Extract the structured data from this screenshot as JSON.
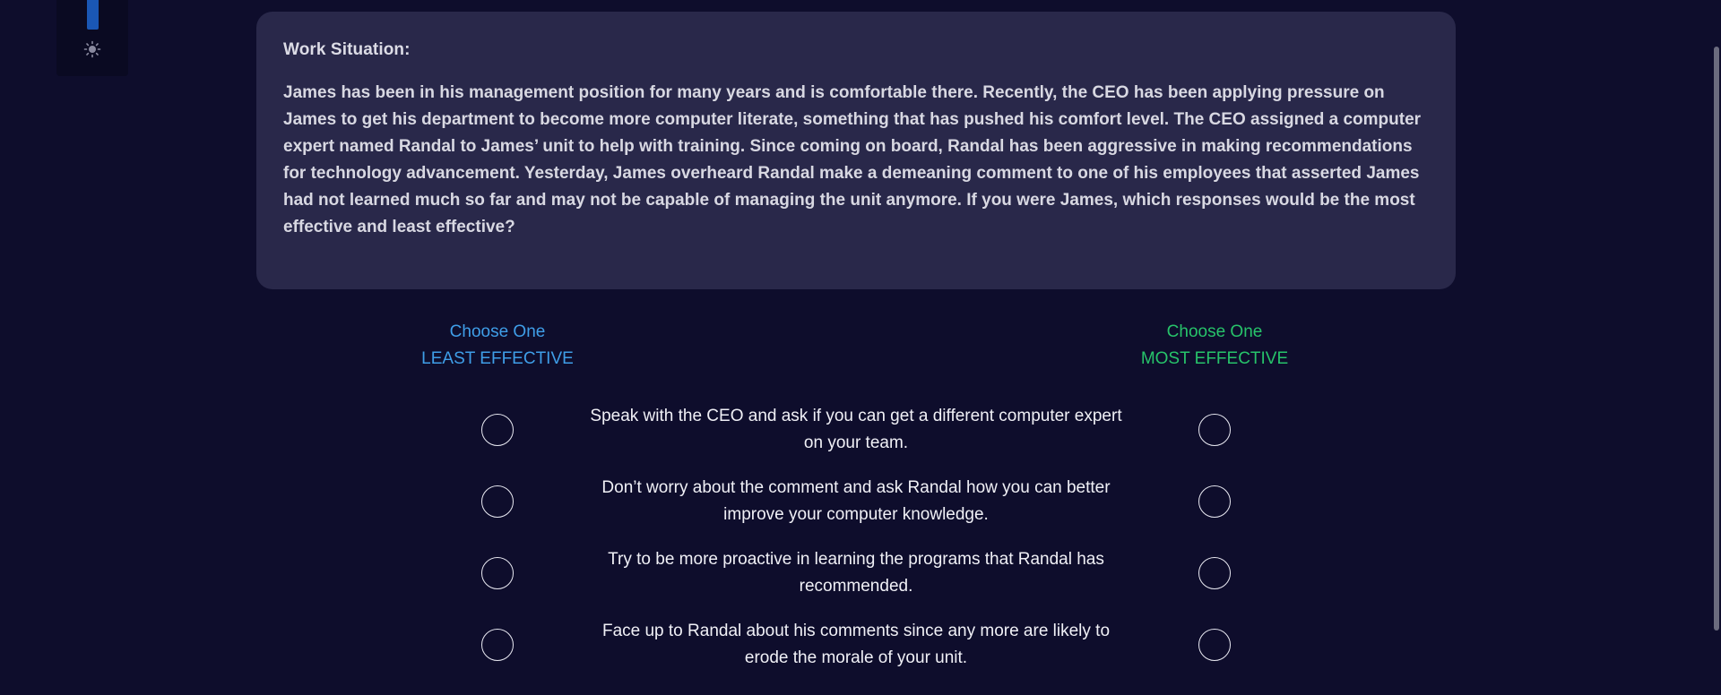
{
  "sidebar": {
    "theme_icon": "sun-icon"
  },
  "situation": {
    "heading": "Work Situation:",
    "text": "James has been in his management position for many years and is comfortable there. Recently, the CEO has been applying pressure on James to get his department to become more computer literate, something that has pushed his comfort level. The CEO assigned a computer expert named Randal to James’ unit to help with training. Since coming on board, Randal has been aggressive in making recommendations for technology advancement. Yesterday, James overheard Randal make a demeaning comment to one of his employees that asserted James had not learned much so far and may not be capable of managing the unit anymore. If you were James, which responses would be the most effective and least effective?"
  },
  "columns": {
    "least": {
      "instruction": "Choose One",
      "label": "LEAST EFFECTIVE",
      "color": "#3f9ee8"
    },
    "most": {
      "instruction": "Choose One",
      "label": "MOST EFFECTIVE",
      "color": "#27c36a"
    }
  },
  "options": [
    {
      "text": "Speak with the CEO and ask if you can get a different computer expert on your team."
    },
    {
      "text": "Don’t worry about the comment and ask Randal how you can better improve your computer knowledge."
    },
    {
      "text": "Try to be more proactive in learning the programs that Randal has recommended."
    },
    {
      "text": "Face up to Randal about his comments since any more are likely to erode the morale of your unit."
    }
  ],
  "colors": {
    "background": "#0e0d2c",
    "card": "#29284a",
    "accent_bar": "#1a57b5"
  }
}
